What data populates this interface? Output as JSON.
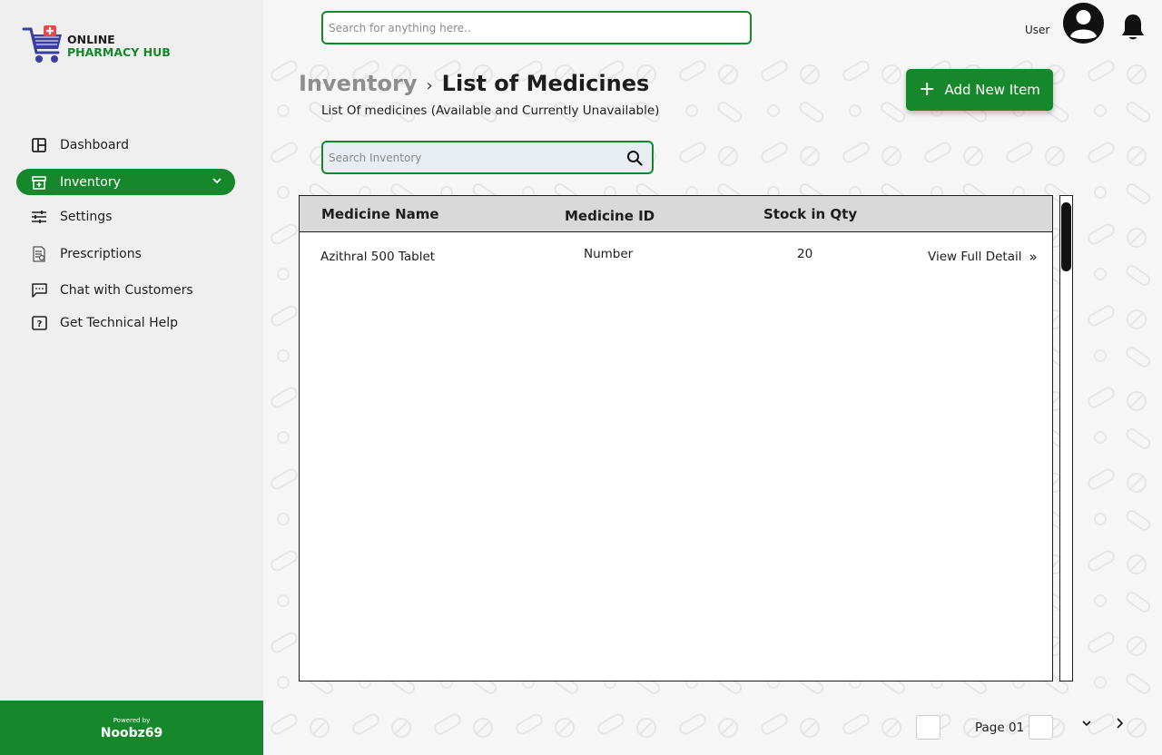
{
  "brand": {
    "line1": "ONLINE",
    "line2": "PHARMACY HUB",
    "powered_by": "Powered by",
    "powered_name": "Noobz69"
  },
  "colors": {
    "accent": "#16872b",
    "sidebar_bg": "#efefef",
    "table_header": "#d9d9d9"
  },
  "sidebar": {
    "items": [
      {
        "label": "Dashboard",
        "icon": "dashboard-icon"
      },
      {
        "label": "Inventory",
        "icon": "inventory-icon",
        "active": true
      },
      {
        "label": "Settings",
        "icon": "sliders-icon"
      },
      {
        "label": "Prescriptions",
        "icon": "prescription-icon"
      },
      {
        "label": "Chat with Customers",
        "icon": "chat-icon"
      },
      {
        "label": "Get Technical Help",
        "icon": "help-icon"
      }
    ]
  },
  "header": {
    "search_placeholder": "Search for anything here..",
    "user_label": "User"
  },
  "page": {
    "breadcrumb_parent": "Inventory",
    "breadcrumb_separator": "›",
    "title": "List of Medicines",
    "subtitle": "List Of medicines (Available and Currently Unavailable)",
    "add_button": "Add New Item",
    "inventory_search_placeholder": "Search Inventory"
  },
  "table": {
    "columns": [
      "Medicine Name",
      "Medicine ID",
      "Stock in Qty"
    ],
    "rows": [
      {
        "name": "Azithral 500 Tablet",
        "id": "Number",
        "stock": "20",
        "action": "View Full Detail"
      }
    ]
  },
  "pagination": {
    "label": "Page 01"
  }
}
